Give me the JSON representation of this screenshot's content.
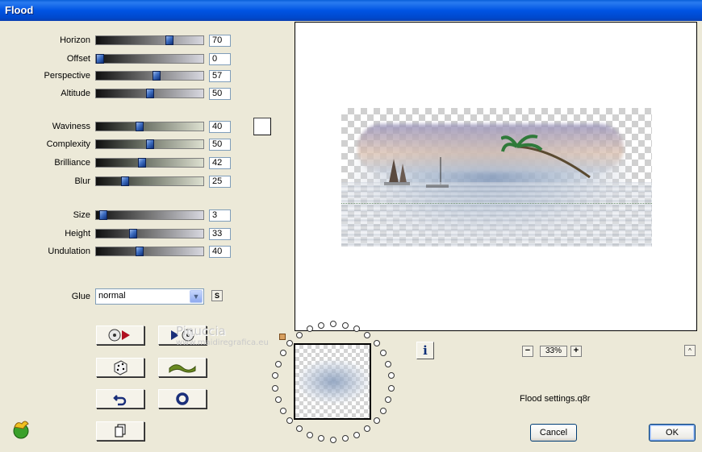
{
  "window": {
    "title": "Flood"
  },
  "sliders": [
    {
      "label": "Horizon",
      "value": "70",
      "level": 0.7
    },
    {
      "label": "Offset",
      "value": "0",
      "level": 0.0
    },
    {
      "label": "Perspective",
      "value": "57",
      "level": 0.57
    },
    {
      "label": "Altitude",
      "value": "50",
      "level": 0.5
    },
    {
      "label": "Waviness",
      "value": "40",
      "level": 0.4
    },
    {
      "label": "Complexity",
      "value": "50",
      "level": 0.5
    },
    {
      "label": "Brilliance",
      "value": "42",
      "level": 0.42
    },
    {
      "label": "Blur",
      "value": "25",
      "level": 0.25
    },
    {
      "label": "Size",
      "value": "3",
      "level": 0.03
    },
    {
      "label": "Height",
      "value": "33",
      "level": 0.33
    },
    {
      "label": "Undulation",
      "value": "40",
      "level": 0.4
    }
  ],
  "glue": {
    "label": "Glue",
    "value": "normal",
    "random_label": "S"
  },
  "watermark": {
    "name": "Pinuccia",
    "site": "www.maidiregrafica.eu"
  },
  "zoom": {
    "minus": "−",
    "value": "33%",
    "plus": "+"
  },
  "collapse": {
    "label": "^"
  },
  "info": {
    "label": "i"
  },
  "settings_file": "Flood settings.q8r",
  "buttons": {
    "cancel": "Cancel",
    "ok": "OK"
  },
  "colors": {
    "titlebar": "#0054e3",
    "dialog_bg": "#ece9d8",
    "thumb": "#3f6fc2",
    "swatch": "#ffffff"
  }
}
